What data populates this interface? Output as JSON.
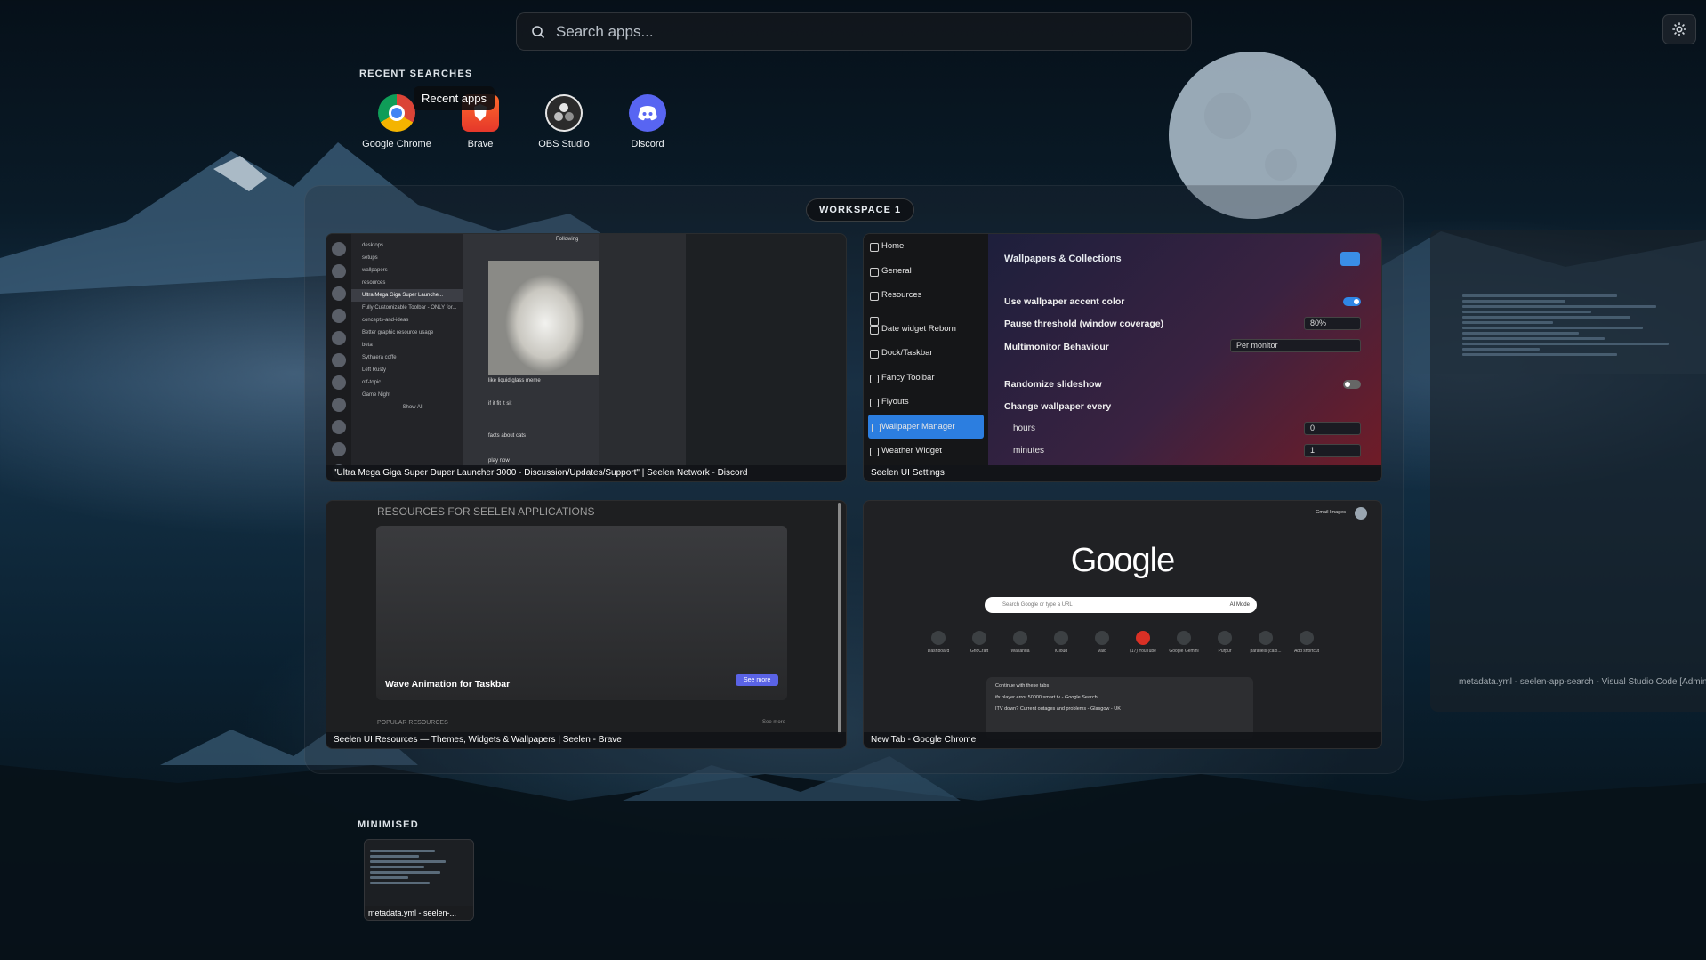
{
  "search": {
    "placeholder": "Search apps..."
  },
  "recent": {
    "label": "RECENT SEARCHES",
    "tooltip": "Recent apps",
    "apps": [
      {
        "name": "Google Chrome",
        "icon": "chrome-icon"
      },
      {
        "name": "Brave",
        "icon": "brave-icon"
      },
      {
        "name": "OBS Studio",
        "icon": "obs-icon"
      },
      {
        "name": "Discord",
        "icon": "discord-icon"
      }
    ]
  },
  "workspace": {
    "title": "WORKSPACE 1",
    "windows": [
      {
        "caption": "\"Ultra Mega Giga Super Duper Launcher 3000 - Discussion/Updates/Support\" | Seelen Network - Discord"
      },
      {
        "caption": "Seelen UI Settings"
      },
      {
        "caption": "Seelen UI Resources — Themes, Widgets & Wallpapers | Seelen - Brave"
      },
      {
        "caption": "New Tab - Google Chrome"
      }
    ]
  },
  "discord": {
    "channels": [
      "desktops",
      "setups",
      "wallpapers",
      "resources",
      "Ultra Mega Giga Super Launche...",
      "Fully Customizable Toolbar - ONLY for...",
      "concepts-and-ideas",
      "Better graphic resource usage",
      "beta",
      "Sythaera coffe",
      "Left Rusty",
      "off-topic",
      "Game Night"
    ],
    "show_all": "Show All",
    "following": "Following",
    "msg_caption": "like liquid glass meme",
    "msg1": "if it fit it sit",
    "msg2": "facts about cats",
    "msg3": "play now"
  },
  "seelen": {
    "nav": [
      "Home",
      "General",
      "Resources",
      "Date widget Reborn",
      "Dock/Taskbar",
      "Fancy Toolbar",
      "Flyouts",
      "Wallpaper Manager",
      "Weather Widget"
    ],
    "active_nav": "Wallpaper Manager",
    "panel_title": "Wallpapers & Collections",
    "use_accent": "Use wallpaper accent color",
    "pause_threshold": "Pause threshold (window coverage)",
    "pause_value": "80%",
    "multimonitor": "Multimonitor Behaviour",
    "multimonitor_value": "Per monitor",
    "randomize": "Randomize slideshow",
    "change_every": "Change wallpaper every",
    "hours_label": "hours",
    "hours_value": "0",
    "minutes_label": "minutes",
    "minutes_value": "1"
  },
  "brave": {
    "heading": "RESOURCES FOR SEELEN APPLICATIONS",
    "card_title": "Wave Animation for Taskbar",
    "see_more": "See more",
    "popular": "POPULAR RESOURCES",
    "see_more_small": "See more"
  },
  "chrome": {
    "logo": "Google",
    "search_placeholder": "Search Google or type a URL",
    "ai_mode": "AI Mode",
    "top_links": "Gmail  Images",
    "shortcuts": [
      "Dashboard",
      "GridCraft",
      "Wakanda",
      "iCloud",
      "Valo",
      "(17) YouTube",
      "Google Gemini",
      "Purpur",
      "parallels (calo...",
      "Add shortcut"
    ],
    "continue_label": "Continue with these tabs",
    "tab1": "ifx player error 50000 smart tv - Google Search",
    "tab2": "ITV down? Current outages and problems - Glasgow - UK"
  },
  "offscreen": {
    "caption": "metadata.yml - seelen-app-search - Visual Studio Code [Administ"
  },
  "minimised": {
    "label": "MINIMISED",
    "caption": "metadata.yml - seelen-..."
  },
  "colors": {
    "accent": "#2c7ee0",
    "discord": "#5865f2"
  }
}
